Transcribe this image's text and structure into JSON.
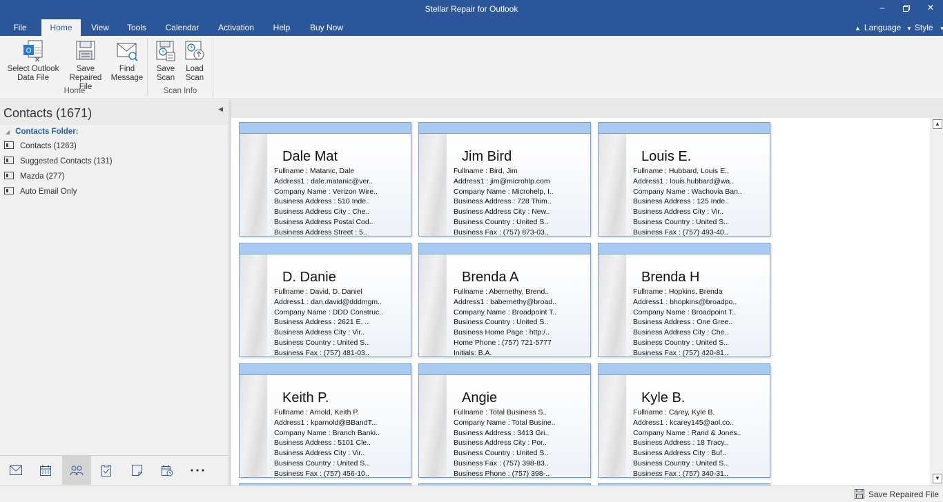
{
  "window": {
    "title": "Stellar Repair for Outlook",
    "minimize": "–",
    "restore": "❐",
    "close": "✕"
  },
  "menu": {
    "tabs": [
      "File",
      "Home",
      "View",
      "Tools",
      "Calendar",
      "Activation",
      "Help",
      "Buy Now"
    ],
    "active_tab": "Home",
    "language": "Language",
    "style": "Style"
  },
  "ribbon": {
    "select_outlook_line1": "Select Outlook",
    "select_outlook_line2": "Data File",
    "save_repaired_line1": "Save",
    "save_repaired_line2": "Repaired File",
    "find_message_line1": "Find",
    "find_message_line2": "Message",
    "save_scan_line1": "Save",
    "save_scan_line2": "Scan",
    "load_scan_line1": "Load",
    "load_scan_line2": "Scan",
    "group_home": "Home",
    "group_scan_info": "Scan Info"
  },
  "left_pane": {
    "title": "Contacts (1671)",
    "root": "Contacts Folder:",
    "folders": [
      "Contacts (1263)",
      "Suggested Contacts (131)",
      "Mazda (277)",
      "Auto Email Only"
    ]
  },
  "cards": [
    {
      "name": "Dale Mat",
      "lines": [
        "Fullname : Matanic, Dale",
        "Address1 : dale.matanic@ver..",
        "Company Name : Verizon Wire..",
        "Business Address : 510 Inde..",
        "Business Address City : Che..",
        "Business Address Postal Cod..",
        "Business Address Street : 5.."
      ]
    },
    {
      "name": "Jim Bird",
      "lines": [
        "Fullname : Bird, Jim",
        "Address1 : jim@microhlp.com",
        "Company Name : Microhelp, I..",
        "Business Address : 728 Thim..",
        "Business Address City : New..",
        "Business Country : United S..",
        "Business Fax : (757) 873-03.."
      ]
    },
    {
      "name": "Louis E.",
      "lines": [
        "Fullname : Hubbard, Louis E..",
        "Address1 : louis.hubbard@wa..",
        "Company Name : Wachovia Ban..",
        "Business Address : 125 Inde..",
        "Business Address City : Vir..",
        "Business Country : United S..",
        "Business Fax : (757) 493-40.."
      ]
    },
    {
      "name": "D. Danie",
      "lines": [
        "Fullname : David, D. Daniel",
        "Address1 : dan.david@dddmgm..",
        "Company Name : DDD Construc..",
        "Business Address : 2621 E. ..",
        "Business Address City : Vir..",
        "Business Country : United S..",
        "Business Fax : (757) 481-03.."
      ]
    },
    {
      "name": "Brenda A",
      "lines": [
        "Fullname : Abernethy, Brend..",
        "Address1 : babernethy@broad..",
        "Company Name : Broadpoint T..",
        "Business Country : United S..",
        "Business Home Page : http:/..",
        "Home Phone : (757) 721-5777",
        "Initials: B.A."
      ]
    },
    {
      "name": "Brenda H",
      "lines": [
        "Fullname : Hopkins, Brenda",
        "Address1 : bhopkins@broadpo..",
        "Company Name : Broadpoint T..",
        "Business Address : One Gree..",
        "Business Address City : Che..",
        "Business Country : United S..",
        "Business Fax : (757) 420-81.."
      ]
    },
    {
      "name": "Keith P.",
      "lines": [
        "Fullname : Arnold, Keith P.",
        "Address1 : kparnold@BBandT...",
        "Company Name : Branch Banki..",
        "Business Address : 5101 Cle..",
        "Business Address City : Vir..",
        "Business Country : United S..",
        "Business Fax : (757) 456-10.."
      ]
    },
    {
      "name": "Angie",
      "lines": [
        "Fullname : Total Business S..",
        "Company Name : Total Busine..",
        "Business Address : 3413 Gri..",
        "Business Address City : Por..",
        "Business Country : United S..",
        "Business Fax : (757) 398-83..",
        "Business Phone : (757) 398-.."
      ]
    },
    {
      "name": "Kyle B.",
      "lines": [
        "Fullname : Carey, Kyle B.",
        "Address1 : kcarey145@aol.co..",
        "Company Name : Rand & Jones..",
        "Business Address : 18 Tracy..",
        "Business Address City : Buf..",
        "Business Country : United S..",
        "Business Fax : (757) 340-31.."
      ]
    }
  ],
  "nav_icons": [
    "mail-icon",
    "calendar-icon",
    "contacts-icon",
    "tasks-icon",
    "notes-icon",
    "journal-icon",
    "more-icon"
  ],
  "status": {
    "save_repaired": "Save Repaired File"
  },
  "colors": {
    "title_blue": "#2b579a",
    "card_header": "#a9cbf2",
    "folder_link": "#1e5fb3"
  }
}
